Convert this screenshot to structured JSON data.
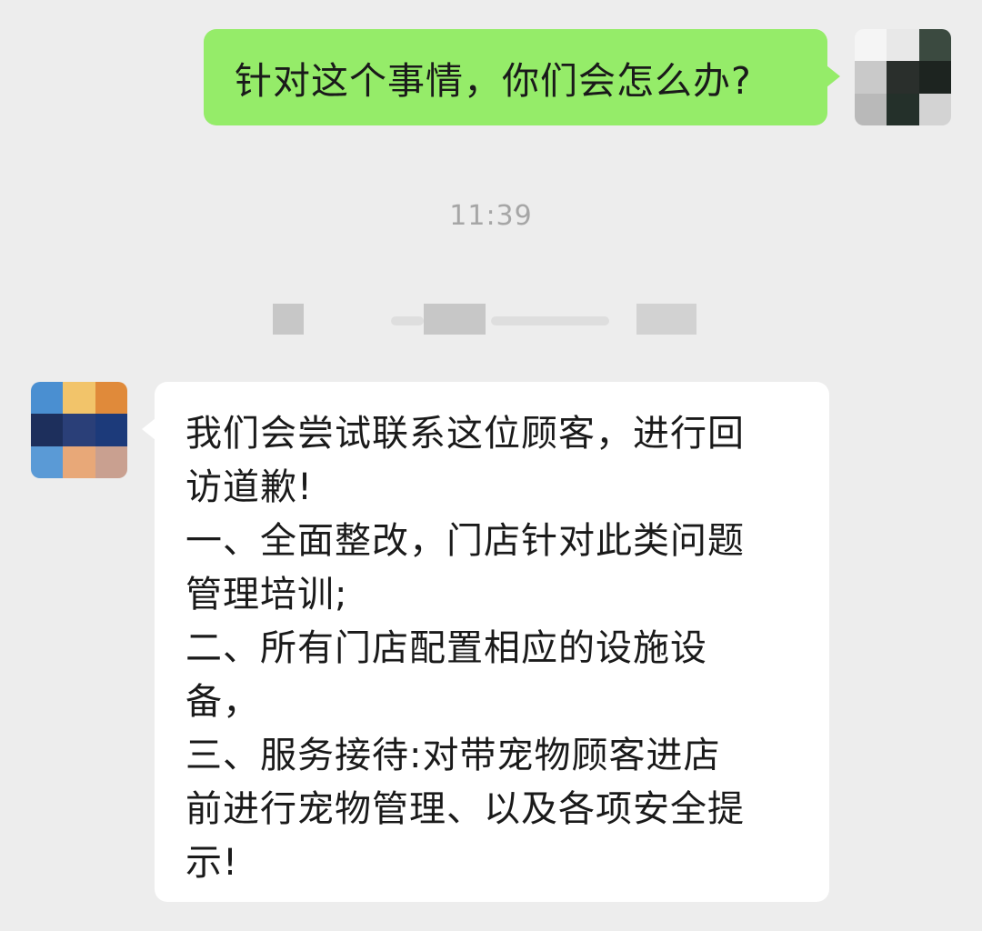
{
  "conversation": {
    "outgoing_message": {
      "text": "针对这个事情，你们会怎么办?"
    },
    "timestamp": "11:39",
    "incoming_message": {
      "lines": [
        "我们会尝试联系这位顾客，进行回",
        "访道歉!",
        "一、全面整改，门店针对此类问题",
        "管理培训;",
        "二、所有门店配置相应的设施设",
        "备，",
        "三、服务接待:对带宠物顾客进店",
        "前进行宠物管理、以及各项安全提",
        "示!"
      ]
    }
  },
  "colors": {
    "background": "#ededed",
    "outgoing_bubble": "#95ec69",
    "incoming_bubble": "#ffffff",
    "timestamp_text": "#a6a6a6"
  },
  "avatars": {
    "self": {
      "pixel_colors": [
        "#f5f5f5",
        "#e8e8e8",
        "#3b4a40",
        "#c9c9c9",
        "#2a2f2c",
        "#1d2420",
        "#b9b9b9",
        "#24302a",
        "#d3d3d3"
      ]
    },
    "other": {
      "pixel_colors": [
        "#4a8fd1",
        "#f2c46a",
        "#e08a3a",
        "#1d2f5c",
        "#2a3f78",
        "#1c3a7a",
        "#5a9ad6",
        "#e8a878",
        "#c9a090"
      ]
    }
  }
}
